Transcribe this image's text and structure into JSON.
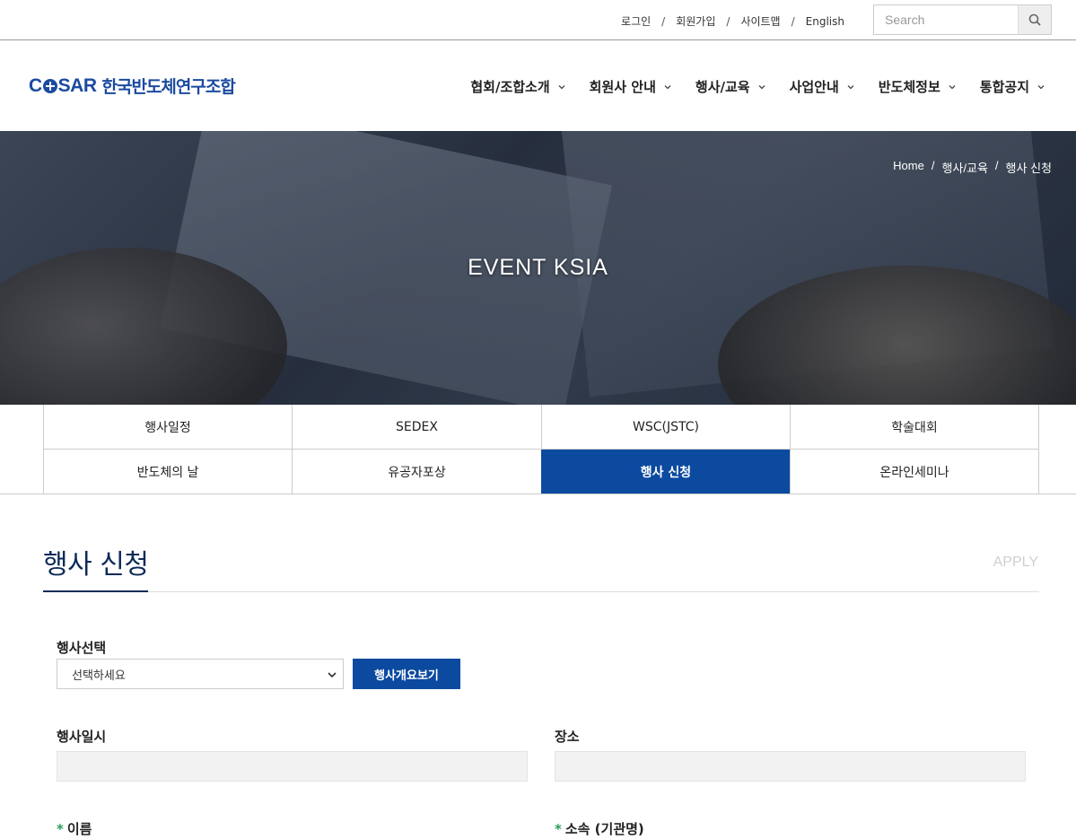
{
  "util": {
    "login": "로그인",
    "join": "회원가입",
    "sitemap": "사이트맵",
    "english": "English",
    "sep": "/"
  },
  "search": {
    "placeholder": "Search",
    "icon": "search-icon"
  },
  "logo": {
    "mark": "COSAR",
    "name": "한국반도체연구조합"
  },
  "gnb": [
    "협회/조합소개",
    "회원사 안내",
    "행사/교육",
    "사업안내",
    "반도체정보",
    "통합공지"
  ],
  "hero": {
    "title": "EVENT KSIA",
    "breadcrumb": [
      "Home",
      "행사/교육",
      "행사 신청"
    ]
  },
  "tabs": [
    {
      "label": "행사일정",
      "active": false
    },
    {
      "label": "SEDEX",
      "active": false
    },
    {
      "label": "WSC(JSTC)",
      "active": false
    },
    {
      "label": "학술대회",
      "active": false
    },
    {
      "label": "반도체의 날",
      "active": false
    },
    {
      "label": "유공자포상",
      "active": false
    },
    {
      "label": "행사 신청",
      "active": true
    },
    {
      "label": "온라인세미나",
      "active": false
    }
  ],
  "page": {
    "title": "행사 신청",
    "sub": "APPLY"
  },
  "form": {
    "event_select_label": "행사선택",
    "event_select_value": "선택하세요",
    "view_button": "행사개요보기",
    "date_label": "행사일시",
    "place_label": "장소",
    "name_label": "이름",
    "org_label": "소속 (기관명)",
    "required_mark": "*"
  },
  "colors": {
    "brand": "#0c4aa0",
    "title": "#0d2a57",
    "required": "#2a9d5c"
  }
}
